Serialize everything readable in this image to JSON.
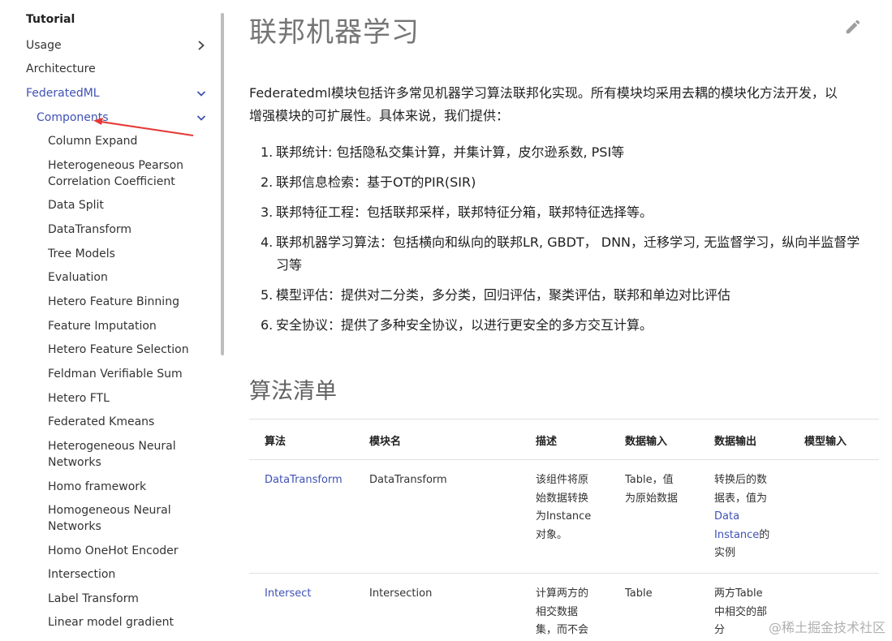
{
  "sidebar": {
    "heading": "Tutorial",
    "usage": "Usage",
    "architecture": "Architecture",
    "federatedml": "FederatedML",
    "components": "Components",
    "items": [
      "Column Expand",
      "Heterogeneous Pearson Correlation Coefficient",
      "Data Split",
      "DataTransform",
      "Tree Models",
      "Evaluation",
      "Hetero Feature Binning",
      "Feature Imputation",
      "Hetero Feature Selection",
      "Feldman Verifiable Sum",
      "Hetero FTL",
      "Federated Kmeans",
      "Heterogeneous Neural Networks",
      "Homo framework",
      "Homogeneous Neural Networks",
      "Homo OneHot Encoder",
      "Intersection",
      "Label Transform",
      "Linear model gradient"
    ]
  },
  "main": {
    "title": "联邦机器学习",
    "intro": "Federatedml模块包括许多常见机器学习算法联邦化实现。所有模块均采用去耦的模块化方法开发，以增强模块的可扩展性。具体来说，我们提供：",
    "features": [
      {
        "num": "1.",
        "text": "联邦统计: 包括隐私交集计算，并集计算，皮尔逊系数, PSI等"
      },
      {
        "num": "2.",
        "text": "联邦信息检索：基于OT的PIR(SIR)"
      },
      {
        "num": "3.",
        "text": "联邦特征工程：包括联邦采样，联邦特征分箱，联邦特征选择等。"
      },
      {
        "num": "4.",
        "text": "联邦机器学习算法：包括横向和纵向的联邦LR, GBDT， DNN，迁移学习, 无监督学习，纵向半监督学习等"
      },
      {
        "num": "5.",
        "text": "模型评估：提供对二分类，多分类，回归评估，聚类评估，联邦和单边对比评估"
      },
      {
        "num": "6.",
        "text": "安全协议：提供了多种安全协议，以进行更安全的多方交互计算。"
      }
    ],
    "section_title": "算法清单",
    "table": {
      "headers": [
        "算法",
        "模块名",
        "描述",
        "数据输入",
        "数据输出",
        "模型输入"
      ],
      "rows": [
        {
          "algo": "DataTransform",
          "module": "DataTransform",
          "desc": [
            "该组件将原",
            "始数据转换",
            "为Instance",
            "对象。"
          ],
          "input": [
            "Table，值",
            "为原始数据"
          ],
          "output_pre": [
            "转换后的数",
            "据表，值为"
          ],
          "output_link": [
            "Data",
            "Instance"
          ],
          "output_post": [
            "的",
            "实例"
          ]
        },
        {
          "algo": "Intersect",
          "module": "Intersection",
          "desc": [
            "计算两方的",
            "相交数据",
            "集，而不会"
          ],
          "input": [
            "Table"
          ],
          "output": [
            "两方Table",
            "中相交的部",
            "分"
          ]
        }
      ]
    }
  },
  "watermark": "@稀土掘金技术社区",
  "icons": {
    "edit": "pencil-icon",
    "chevron_right": "chevron-right-icon",
    "chevron_down": "chevron-down-icon"
  },
  "colors": {
    "accent": "#3f51b5",
    "annotation": "#e53935"
  }
}
